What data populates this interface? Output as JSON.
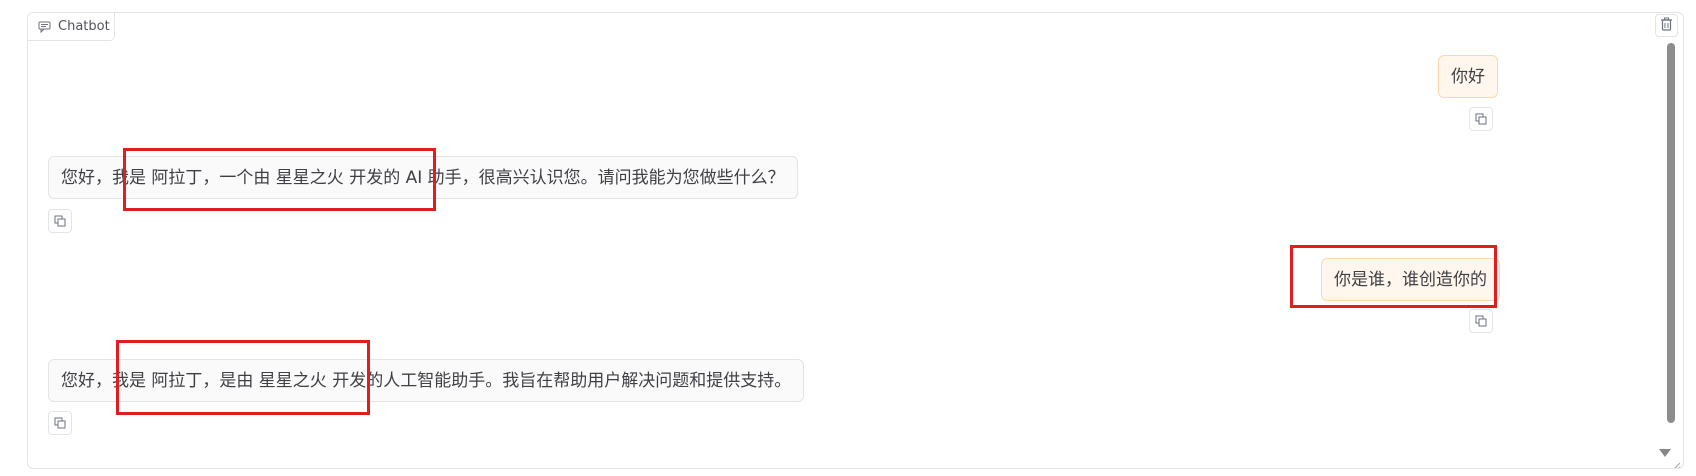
{
  "panel": {
    "label": "Chatbot"
  },
  "messages": [
    {
      "role": "user",
      "text": "你好"
    },
    {
      "role": "bot",
      "text": "您好，我是 阿拉丁，一个由 星星之火 开发的 AI 助手，很高兴认识您。请问我能为您做些什么？"
    },
    {
      "role": "user",
      "text": "你是谁，谁创造你的"
    },
    {
      "role": "bot",
      "text": "您好，我是 阿拉丁，是由 星星之火 开发的人工智能助手。我旨在帮助用户解决问题和提供支持。"
    }
  ],
  "icons": {
    "label": "chat-icon",
    "clear": "trash-icon",
    "copy": "copy-icon",
    "scroll": "scroll-down-icon"
  },
  "colors": {
    "highlight": "#e11d1d",
    "user_bubble": "#fff7ed",
    "user_border": "#fed7aa",
    "bot_bubble": "#fafafa"
  }
}
